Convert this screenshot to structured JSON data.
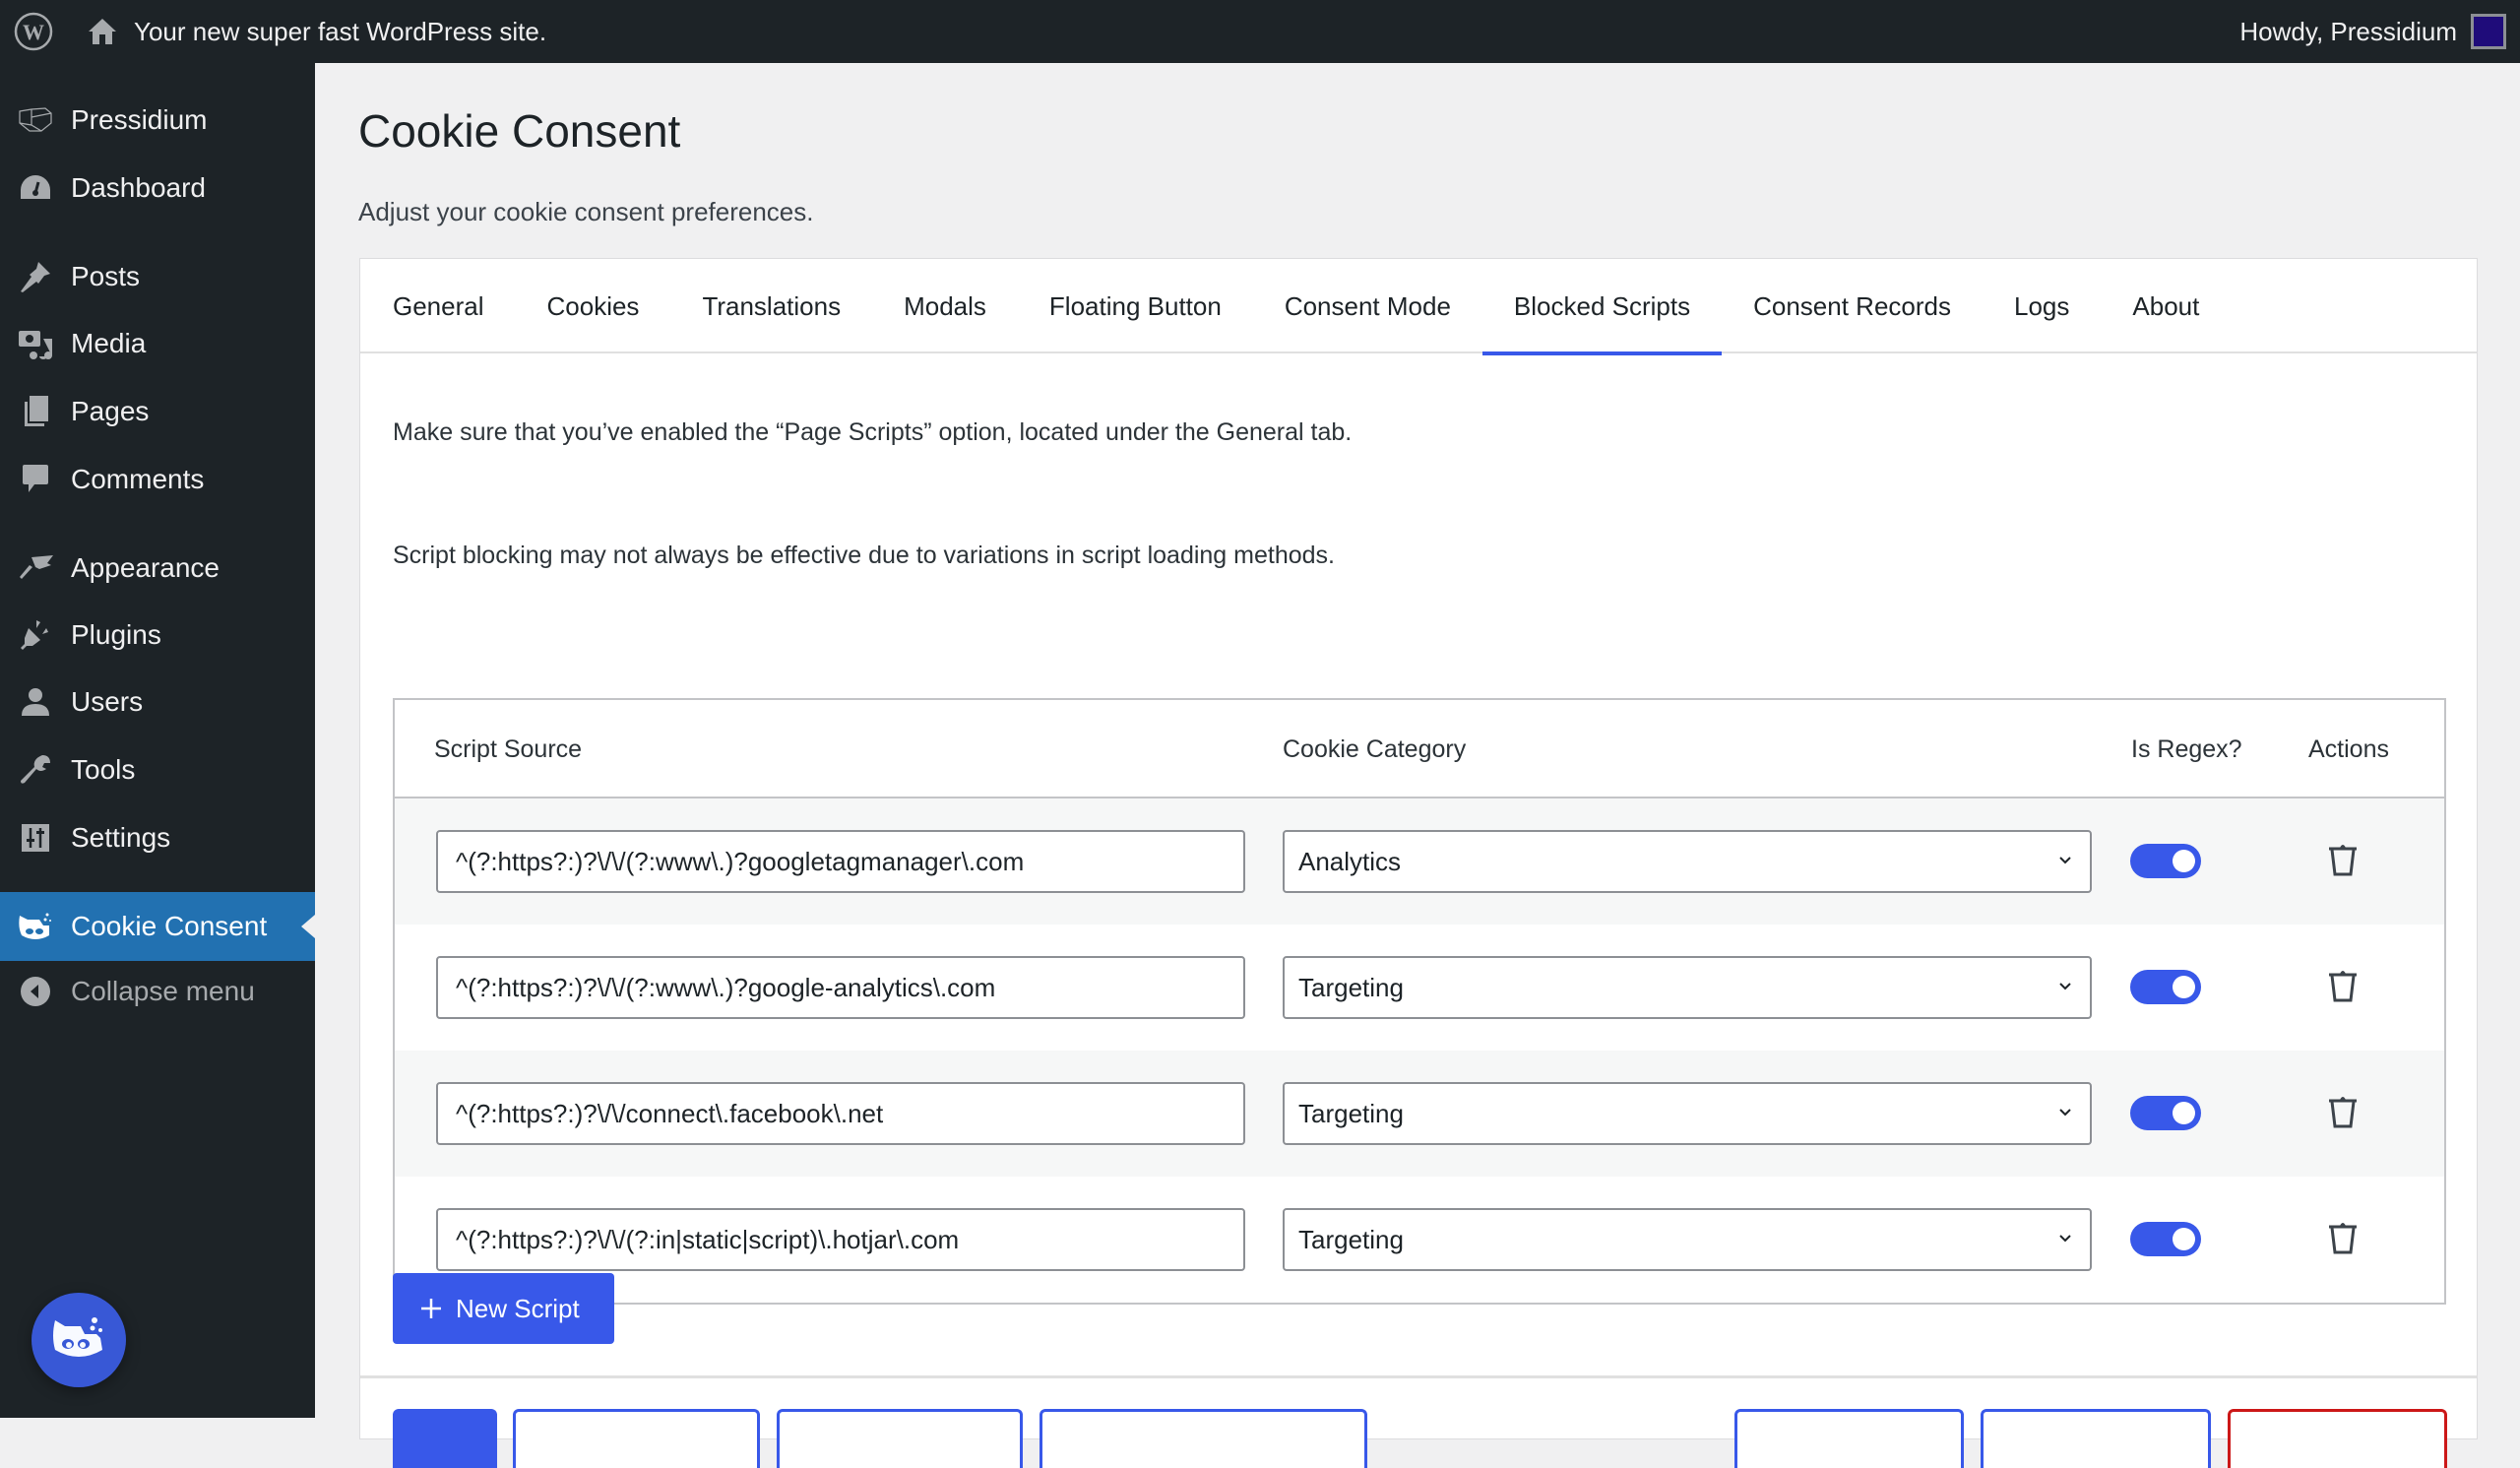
{
  "adminbar": {
    "site_name": "Your new super fast WordPress site.",
    "greeting": "Howdy, Pressidium",
    "icons": [
      "wordpress-logo-icon",
      "home-icon",
      "user-avatar-icon"
    ]
  },
  "sidebar": {
    "items": [
      {
        "label": "Pressidium",
        "icon": "pressidium-icon"
      },
      {
        "label": "Dashboard",
        "icon": "dashboard-icon"
      },
      {
        "label": "Posts",
        "icon": "pin-icon"
      },
      {
        "label": "Media",
        "icon": "media-icon"
      },
      {
        "label": "Pages",
        "icon": "pages-icon"
      },
      {
        "label": "Comments",
        "icon": "comment-icon"
      },
      {
        "label": "Appearance",
        "icon": "paintbrush-icon"
      },
      {
        "label": "Plugins",
        "icon": "plugin-icon"
      },
      {
        "label": "Users",
        "icon": "user-icon"
      },
      {
        "label": "Tools",
        "icon": "wrench-icon"
      },
      {
        "label": "Settings",
        "icon": "settings-icon"
      },
      {
        "label": "Cookie Consent",
        "icon": "cookie-consent-icon",
        "active": true
      }
    ],
    "collapse_label": "Collapse menu"
  },
  "page": {
    "title": "Cookie Consent",
    "subtitle": "Adjust your cookie consent preferences."
  },
  "tabs": [
    {
      "label": "General"
    },
    {
      "label": "Cookies"
    },
    {
      "label": "Translations"
    },
    {
      "label": "Modals"
    },
    {
      "label": "Floating Button"
    },
    {
      "label": "Consent Mode"
    },
    {
      "label": "Blocked Scripts",
      "active": true
    },
    {
      "label": "Consent Records"
    },
    {
      "label": "Logs"
    },
    {
      "label": "About"
    }
  ],
  "notes": {
    "line1": "Make sure that you’ve enabled the “Page Scripts” option, located under the General tab.",
    "line2": "Script blocking may not always be effective due to variations in script loading methods."
  },
  "table": {
    "headers": {
      "source": "Script Source",
      "category": "Cookie Category",
      "regex": "Is Regex?",
      "actions": "Actions"
    },
    "rows": [
      {
        "source": "^(?:https?:)?\\/\\/(?:www\\.)?googletagmanager\\.com",
        "category": "Analytics",
        "is_regex": true
      },
      {
        "source": "^(?:https?:)?\\/\\/(?:www\\.)?google-analytics\\.com",
        "category": "Targeting",
        "is_regex": true
      },
      {
        "source": "^(?:https?:)?\\/\\/connect\\.facebook\\.net",
        "category": "Targeting",
        "is_regex": true
      },
      {
        "source": "^(?:https?:)?\\/\\/(?:in|static|script)\\.hotjar\\.com",
        "category": "Targeting",
        "is_regex": true
      }
    ]
  },
  "buttons": {
    "new_script": "New Script"
  },
  "colors": {
    "accent": "#3858e9",
    "wp_blue": "#2271b1",
    "danger": "#cc1818",
    "adminbar_bg": "#1d2327"
  }
}
